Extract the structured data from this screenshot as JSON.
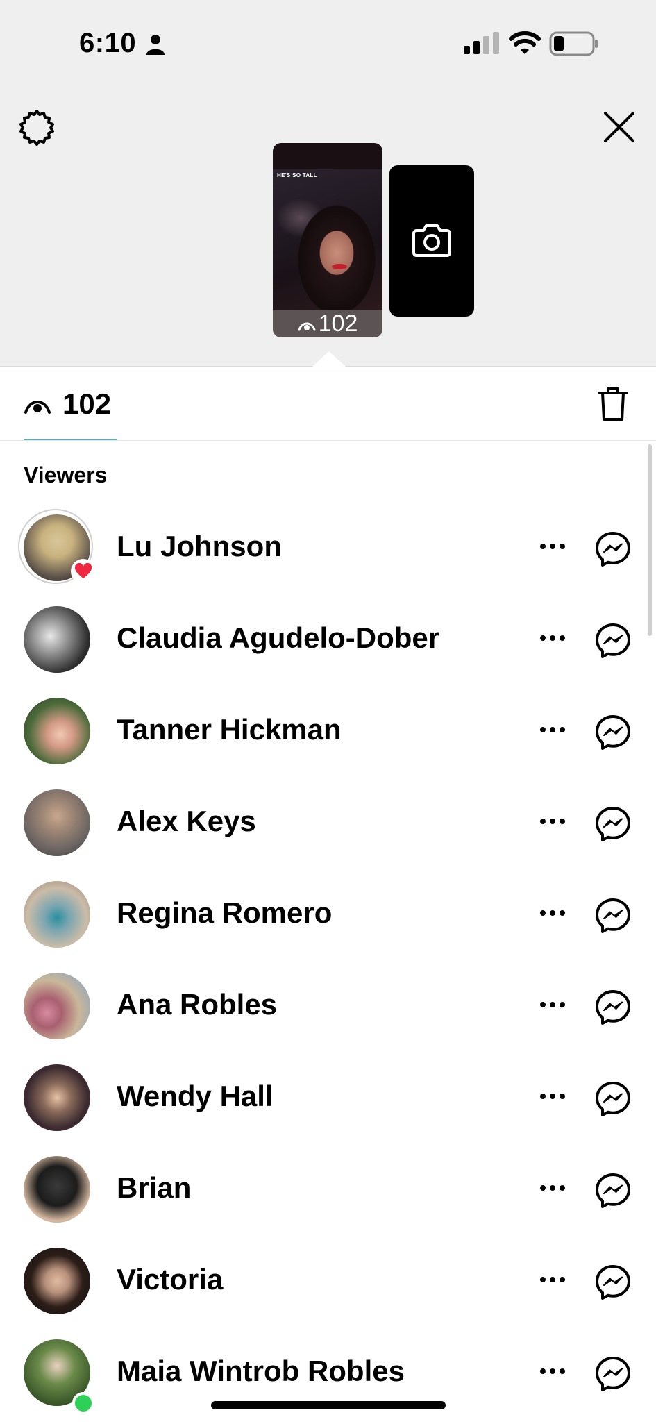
{
  "status_bar": {
    "time": "6:10"
  },
  "story": {
    "caption": "HE'S SO TALL",
    "view_count": "102"
  },
  "views": {
    "count": "102"
  },
  "viewers_section": {
    "title": "Viewers"
  },
  "viewers": [
    {
      "name": "Lu Johnson",
      "liked": true,
      "online": false
    },
    {
      "name": "Claudia Agudelo-Dober",
      "liked": false,
      "online": false
    },
    {
      "name": "Tanner Hickman",
      "liked": false,
      "online": false
    },
    {
      "name": "Alex Keys",
      "liked": false,
      "online": false
    },
    {
      "name": "Regina Romero",
      "liked": false,
      "online": false
    },
    {
      "name": "Ana Robles",
      "liked": false,
      "online": false
    },
    {
      "name": "Wendy Hall",
      "liked": false,
      "online": false
    },
    {
      "name": "Brian",
      "liked": false,
      "online": false
    },
    {
      "name": "Victoria",
      "liked": false,
      "online": false
    },
    {
      "name": "Maia Wintrob Robles",
      "liked": false,
      "online": true
    }
  ],
  "colors": {
    "like": "#ef2640",
    "online": "#2ed158",
    "tab_underline": "#60aab6"
  }
}
